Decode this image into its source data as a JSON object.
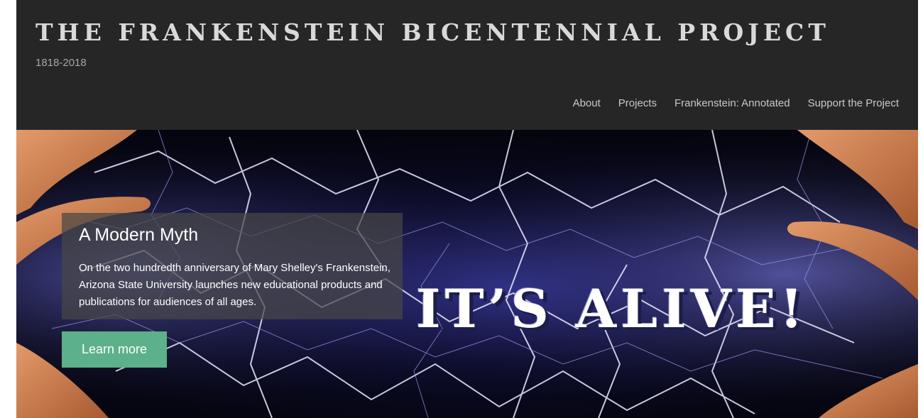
{
  "header": {
    "site_title": "THE FRANKENSTEIN BICENTENNIAL PROJECT",
    "tagline": "1818-2018"
  },
  "nav": {
    "items": [
      {
        "label": "About"
      },
      {
        "label": "Projects"
      },
      {
        "label": "Frankenstein: Annotated"
      },
      {
        "label": "Support the Project"
      }
    ]
  },
  "hero": {
    "caption_title": "A Modern Myth",
    "caption_text": "On the two hundredth anniversary of Mary Shelley's Frankenstein, Arizona State University launches new educational products and publications for audiences of all ages.",
    "button_label": "Learn more",
    "image_text": "IT’S ALIVE!",
    "image_subject": "lightning between hands"
  },
  "colors": {
    "page_background": "#262626",
    "title_text": "#d9d9d9",
    "nav_text": "#c9c9c9",
    "button_background": "#5cb08a"
  }
}
